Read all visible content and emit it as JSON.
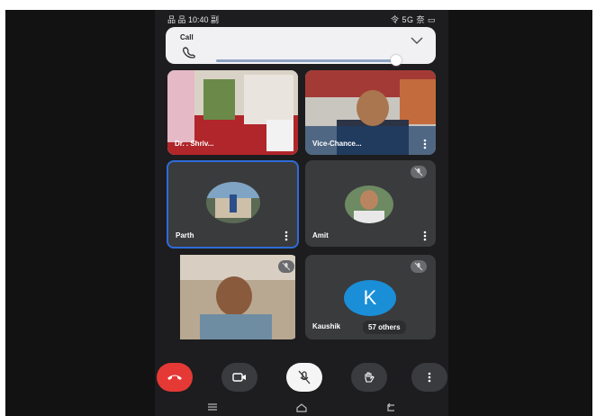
{
  "status_bar": {
    "left": "品 品 10:40 副",
    "right": "令 5G 奈 ▭"
  },
  "call_bar": {
    "label": "Call"
  },
  "participants": [
    {
      "name": "Dr. . Shriv..."
    },
    {
      "name": "Vice-Chance..."
    },
    {
      "name": "Parth"
    },
    {
      "name": "Amit"
    },
    {
      "name": ""
    },
    {
      "name": "Kaushik",
      "initial": "K",
      "others": "57 others"
    }
  ],
  "controls": [
    "end-call",
    "camera",
    "mic-off",
    "raise-hand",
    "more"
  ],
  "colors": {
    "end_call": "#e53935",
    "active_tile_border": "#2f6bd8",
    "avatar_k": "#1a8fd8"
  }
}
